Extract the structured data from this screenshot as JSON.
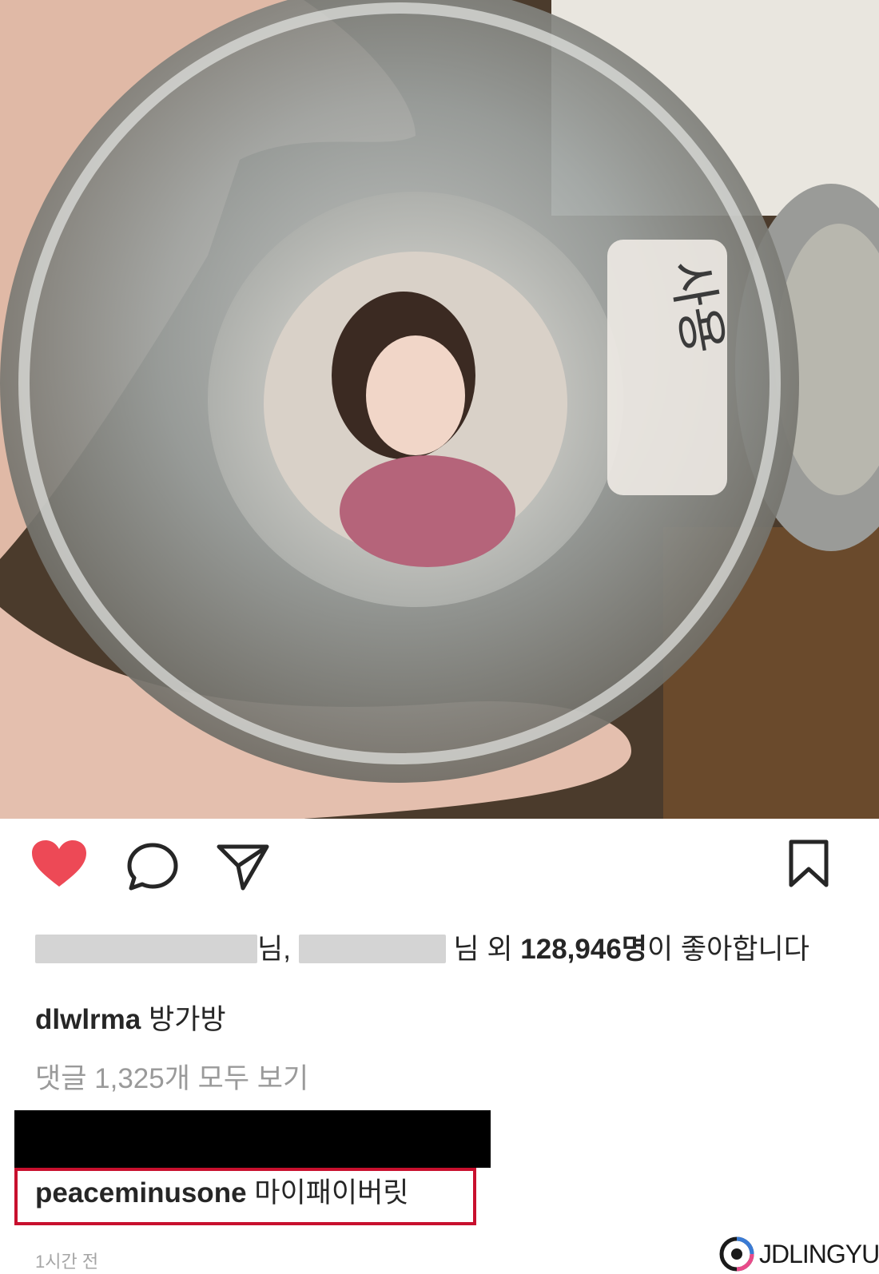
{
  "post": {
    "likes_suffix_1": "님,",
    "likes_suffix_2": "님 외",
    "likes_count": "128,946명",
    "likes_tail": "이 좋아합니다",
    "caption_user": "dlwlrma",
    "caption_text": "방가방",
    "view_comments": "댓글 1,325개 모두 보기",
    "highlight_user": "peaceminusone",
    "highlight_text": "마이패이버릿",
    "timestamp": "1시간 전"
  },
  "watermark": {
    "text": "JDLINGYU"
  },
  "icons": [
    "heart-icon",
    "comment-icon",
    "share-icon",
    "bookmark-icon"
  ],
  "colors": {
    "like": "#ed4956",
    "highlight_border": "#c8102e"
  }
}
